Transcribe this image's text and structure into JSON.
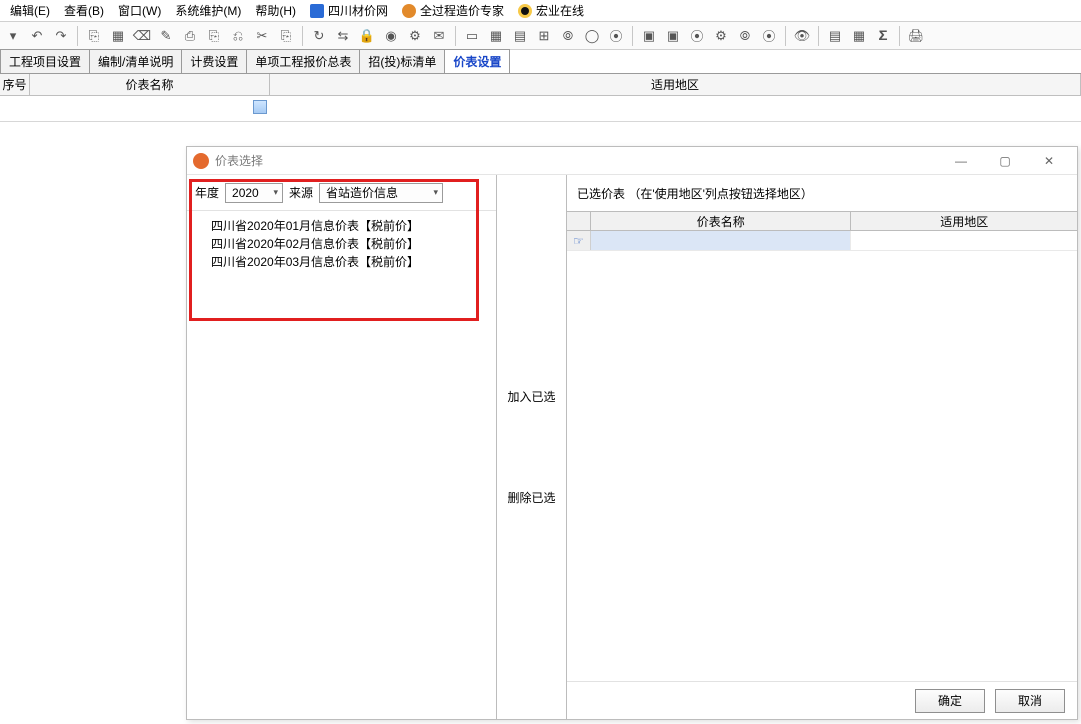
{
  "menu": {
    "items": [
      "编辑(E)",
      "查看(B)",
      "窗口(W)",
      "系统维护(M)",
      "帮助(H)"
    ],
    "ext": [
      {
        "icon": "ext-blue",
        "label": "四川材价网"
      },
      {
        "icon": "ext-orange",
        "label": "全过程造价专家"
      },
      {
        "icon": "ext-qq",
        "label": "宏业在线"
      }
    ]
  },
  "toolbar_icons": [
    "▾",
    "↶",
    "↷",
    "",
    "⎘",
    "▦",
    "⌫",
    "✎",
    "⎙",
    "⎘",
    "⎌",
    "✂",
    "⎘",
    "",
    "↻",
    "⇆",
    "🔒",
    "◉",
    "⚙",
    "✉",
    "",
    "▭",
    "▦",
    "▤",
    "⊞",
    "⦾",
    "◯",
    "⦿",
    "",
    "▣",
    "▣",
    "⦿",
    "⚙",
    "⦾",
    "⦿",
    "",
    "👁",
    "",
    "▤",
    "▦",
    "𝚺",
    "",
    "🖨"
  ],
  "tabs": {
    "items": [
      "工程项目设置",
      "编制/清单说明",
      "计费设置",
      "单项工程报价总表",
      "招(投)标清单",
      "价表设置"
    ],
    "active_index": 5
  },
  "grid": {
    "headers": {
      "serial": "序号",
      "name": "价表名称",
      "region": "适用地区"
    }
  },
  "dialog": {
    "title": "价表选择",
    "filter": {
      "year_label": "年度",
      "year_value": "2020",
      "source_label": "来源",
      "source_value": "省站造价信息"
    },
    "source_items": [
      "四川省2020年01月信息价表【税前价】",
      "四川省2020年02月信息价表【税前价】",
      "四川省2020年03月信息价表【税前价】"
    ],
    "xfer": {
      "add": "加入已选",
      "remove": "删除已选"
    },
    "selected": {
      "caption": "已选价表  （在'使用地区'列点按钮选择地区）",
      "headers": {
        "name": "价表名称",
        "region": "适用地区"
      },
      "pointer": "☞"
    },
    "buttons": {
      "ok": "确定",
      "cancel": "取消"
    },
    "sys": {
      "min": "—",
      "max": "▢",
      "close": "✕"
    }
  }
}
